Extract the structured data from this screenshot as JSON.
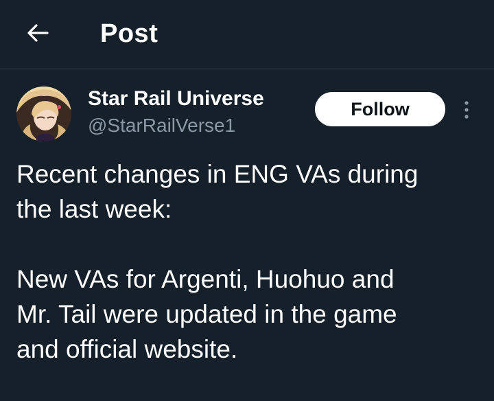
{
  "header": {
    "title": "Post",
    "back_icon": "arrow-left-icon"
  },
  "author": {
    "display_name": "Star Rail Universe",
    "handle": "@StarRailVerse1",
    "avatar_icon": "avatar-illustration"
  },
  "actions": {
    "follow_label": "Follow",
    "more_icon": "vertical-ellipsis-icon"
  },
  "post": {
    "paragraphs": [
      "Recent changes in ENG VAs during\nthe last week:",
      "New VAs for Argenti, Huohuo and\nMr. Tail were updated in the game\nand official website."
    ]
  },
  "colors": {
    "background": "#15202b",
    "divider": "#38444d",
    "text_primary": "#ffffff",
    "text_secondary": "#8b98a5",
    "button_bg": "#ffffff",
    "button_text": "#0f1419"
  }
}
